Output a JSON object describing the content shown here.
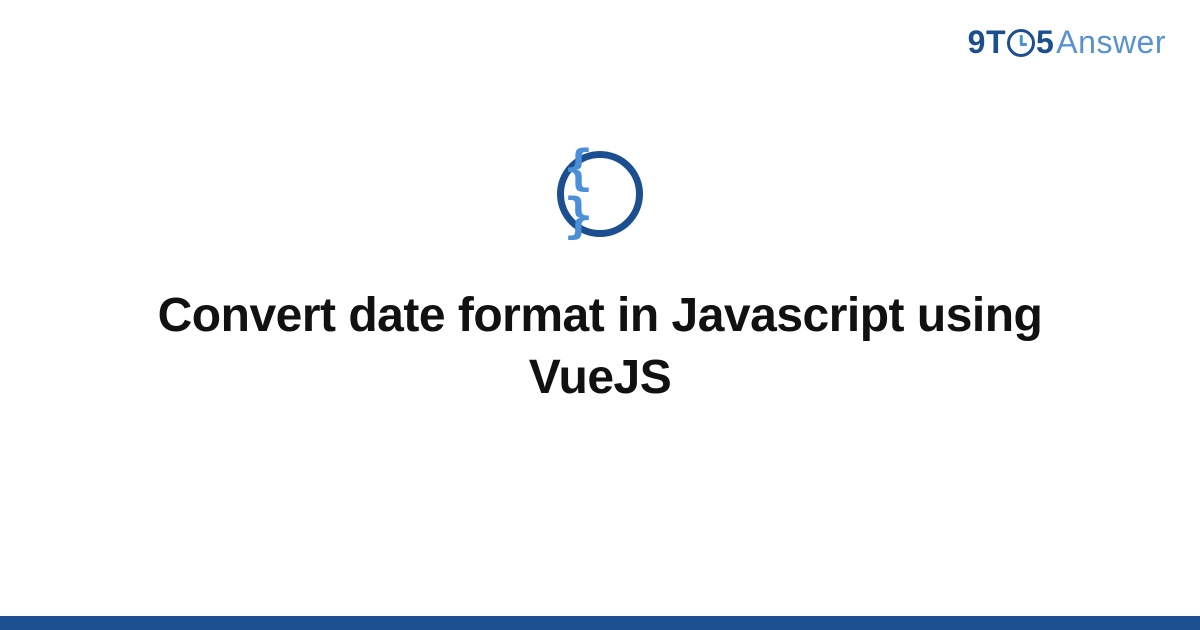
{
  "logo": {
    "part1": "9T",
    "part2": "5",
    "part3": "Answer"
  },
  "category_icon": {
    "name": "code-braces-icon",
    "glyph": "{ }"
  },
  "title": "Convert date format in Javascript using VueJS",
  "colors": {
    "brand_dark": "#1b4f8f",
    "brand_light": "#5892d0",
    "accent": "#4a8fd8"
  }
}
